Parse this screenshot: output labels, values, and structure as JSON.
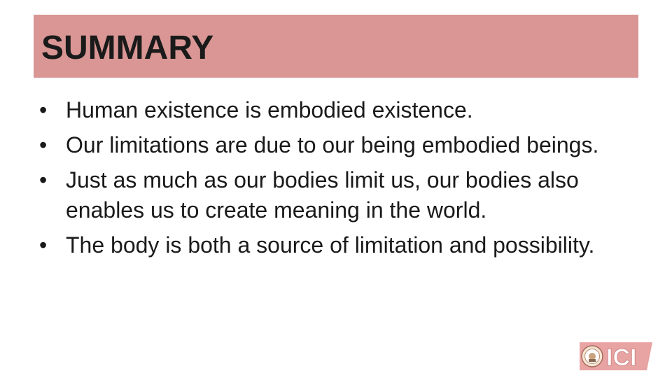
{
  "slide": {
    "title": "SUMMARY",
    "bullets": [
      "Human existence is embodied existence.",
      "Our limitations are due to our being embodied beings.",
      "Just as much as our bodies limit us, our bodies also enables us to create meaning in the world.",
      "The body is both a source of limitation and possibility."
    ],
    "bullet_glyph": "•"
  },
  "logo": {
    "text": "ICI",
    "icon": "seal-emblem-icon"
  },
  "colors": {
    "title_band": "#d99694",
    "logo_pink": "#e8a3a3",
    "text": "#1a1a1a"
  }
}
